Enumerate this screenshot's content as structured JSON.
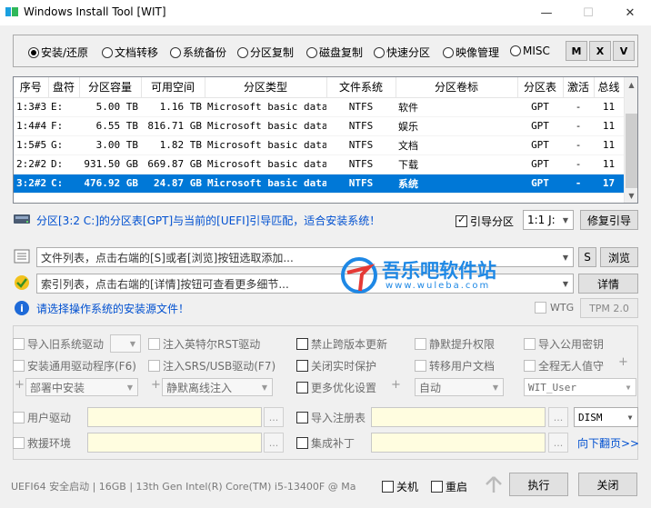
{
  "window": {
    "title": "Windows Install Tool [WIT]",
    "minimize": "—",
    "maximize": "☐",
    "close": "✕"
  },
  "modes": [
    {
      "label": "安装/还原",
      "selected": true
    },
    {
      "label": "文档转移",
      "selected": false
    },
    {
      "label": "系统备份",
      "selected": false
    },
    {
      "label": "分区复制",
      "selected": false
    },
    {
      "label": "磁盘复制",
      "selected": false
    },
    {
      "label": "快速分区",
      "selected": false
    },
    {
      "label": "映像管理",
      "selected": false
    },
    {
      "label": "MISC",
      "selected": false
    }
  ],
  "mode_buttons": [
    "M",
    "X",
    "V"
  ],
  "table": {
    "headers": [
      "序号",
      "盘符",
      "分区容量",
      "可用空间",
      "分区类型",
      "文件系统",
      "分区卷标",
      "分区表",
      "激活",
      "总线"
    ],
    "rows": [
      [
        "1:3#3",
        "E:",
        "5.00 TB",
        "1.16 TB",
        "Microsoft basic data",
        "NTFS",
        "软件",
        "GPT",
        "-",
        "11"
      ],
      [
        "1:4#4",
        "F:",
        "6.55 TB",
        "816.71 GB",
        "Microsoft basic data",
        "NTFS",
        "娱乐",
        "GPT",
        "-",
        "11"
      ],
      [
        "1:5#5",
        "G:",
        "3.00 TB",
        "1.82 TB",
        "Microsoft basic data",
        "NTFS",
        "文档",
        "GPT",
        "-",
        "11"
      ],
      [
        "2:2#2",
        "D:",
        "931.50 GB",
        "669.87 GB",
        "Microsoft basic data",
        "NTFS",
        "下载",
        "GPT",
        "-",
        "11"
      ],
      [
        "3:2#2",
        "C:",
        "476.92 GB",
        "24.87 GB",
        "Microsoft basic data",
        "NTFS",
        "系统",
        "GPT",
        "-",
        "17"
      ]
    ],
    "selected_row": 4
  },
  "status": {
    "message": "分区[3:2 C:]的分区表[GPT]与当前的[UEFI]引导匹配，适合安装系统！",
    "boot_partition_label": "引导分区",
    "boot_partition_checked": true,
    "boot_select": "1:1 J:",
    "repair_boot": "修复引导"
  },
  "file_list": {
    "placeholder": "文件列表，点击右端的[S]或者[浏览]按钮选取添加...",
    "s_button": "S",
    "browse_button": "浏览"
  },
  "index_list": {
    "placeholder": "索引列表，点击右端的[详情]按钮可查看更多细节...",
    "details_button": "详情"
  },
  "source_hint": "请选择操作系统的安装源文件！",
  "wtg": {
    "label": "WTG",
    "tpm_button": "TPM 2.0"
  },
  "options": {
    "col1": [
      "导入旧系统驱动",
      "安装通用驱动程序(F6)"
    ],
    "col2": [
      "注入英特尔RST驱动",
      "注入SRS/USB驱动(F7)"
    ],
    "col3": [
      "禁止跨版本更新",
      "关闭实时保护",
      "更多优化设置"
    ],
    "col4": [
      "静默提升权限",
      "转移用户文档"
    ],
    "col5": [
      "导入公用密钥",
      "全程无人值守"
    ],
    "deploy_select": "部署中安装",
    "silent_select": "静默离线注入",
    "auto_select": "自动",
    "user_select": "WIT_User",
    "user_driver": "用户驱动",
    "rescue_env": "救援环境",
    "import_registry": "导入注册表",
    "integrate_patch": "集成补丁",
    "dism_select": "DISM",
    "next_page": "向下翻页>>",
    "dots": "..."
  },
  "watermark": {
    "name": "吾乐吧软件站",
    "url": "www.wuleba.com"
  },
  "footer": {
    "info": "UEFI64 安全启动 | 16GB | 13th Gen Intel(R) Core(TM) i5-13400F @ Ma",
    "shutdown": "关机",
    "restart": "重启",
    "execute": "执行",
    "close": "关闭"
  },
  "colors": {
    "selection": "#0078d7",
    "status_text": "#0050d0",
    "link": "#0050d0"
  }
}
